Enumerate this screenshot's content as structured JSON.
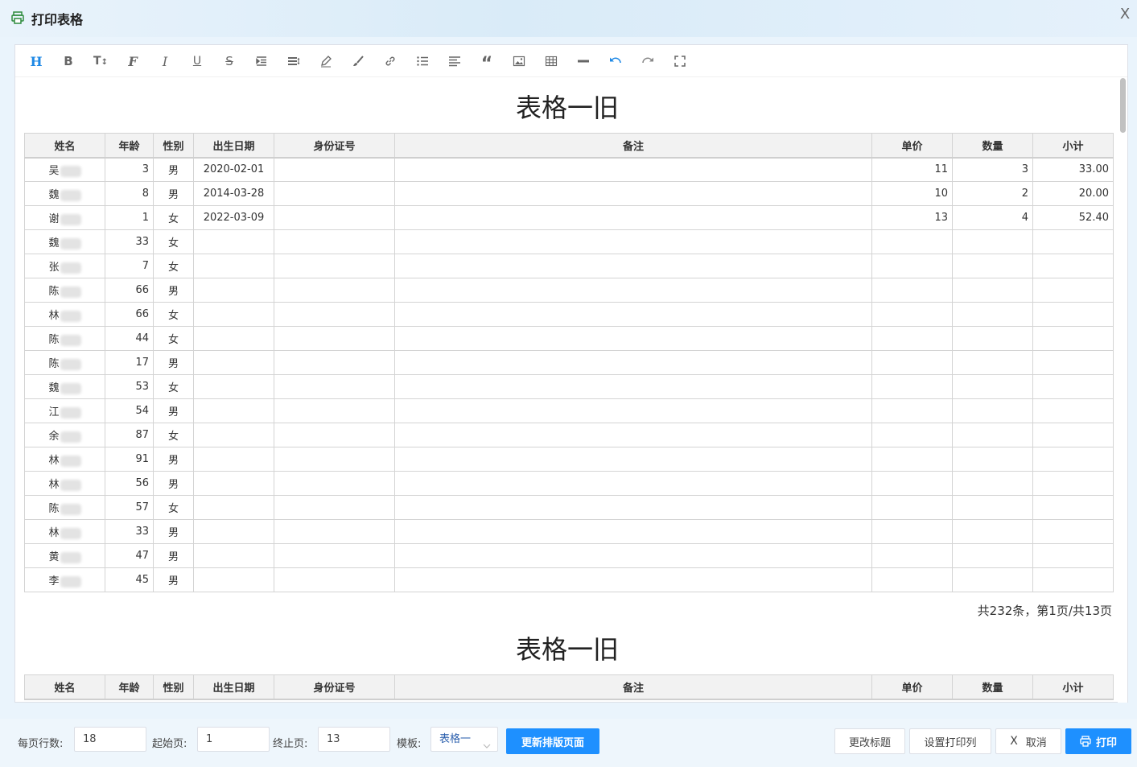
{
  "window": {
    "title": "打印表格",
    "close_label": "X"
  },
  "toolbar": {
    "items": [
      {
        "name": "heading-icon",
        "glyph": "H"
      },
      {
        "name": "bold-icon",
        "glyph": "B"
      },
      {
        "name": "font-size-icon",
        "glyph": "TI"
      },
      {
        "name": "font-family-icon",
        "glyph": "F"
      },
      {
        "name": "italic-icon",
        "glyph": "I"
      },
      {
        "name": "underline-icon",
        "glyph": "U"
      },
      {
        "name": "strikethrough-icon",
        "glyph": "S"
      },
      {
        "name": "indent-icon",
        "glyph": "indent"
      },
      {
        "name": "line-height-icon",
        "glyph": "lh"
      },
      {
        "name": "font-color-icon",
        "glyph": "pen"
      },
      {
        "name": "background-color-icon",
        "glyph": "brush"
      },
      {
        "name": "link-icon",
        "glyph": "link"
      },
      {
        "name": "list-icon",
        "glyph": "list"
      },
      {
        "name": "align-icon",
        "glyph": "align"
      },
      {
        "name": "quote-icon",
        "glyph": "quote"
      },
      {
        "name": "image-icon",
        "glyph": "image"
      },
      {
        "name": "table-icon",
        "glyph": "table"
      },
      {
        "name": "divider-icon",
        "glyph": "hr"
      },
      {
        "name": "undo-icon",
        "glyph": "undo"
      },
      {
        "name": "redo-icon",
        "glyph": "redo"
      },
      {
        "name": "fullscreen-icon",
        "glyph": "full"
      }
    ],
    "accent": "#1e88e5"
  },
  "document": {
    "page_title": "表格一旧",
    "columns": [
      "姓名",
      "年龄",
      "性别",
      "出生日期",
      "身份证号",
      "备注",
      "单价",
      "数量",
      "小计"
    ],
    "rows": [
      {
        "name": "吴",
        "age": "3",
        "sex": "男",
        "dob": "2020-02-01",
        "id": "",
        "note": "",
        "price": "11",
        "qty": "3",
        "sub": "33.00"
      },
      {
        "name": "魏",
        "age": "8",
        "sex": "男",
        "dob": "2014-03-28",
        "id": "",
        "note": "",
        "price": "10",
        "qty": "2",
        "sub": "20.00"
      },
      {
        "name": "谢",
        "age": "1",
        "sex": "女",
        "dob": "2022-03-09",
        "id": "",
        "note": "",
        "price": "13",
        "qty": "4",
        "sub": "52.40"
      },
      {
        "name": "魏",
        "age": "33",
        "sex": "女",
        "dob": "",
        "id": "",
        "note": "",
        "price": "",
        "qty": "",
        "sub": ""
      },
      {
        "name": "张",
        "age": "7",
        "sex": "女",
        "dob": "",
        "id": "",
        "note": "",
        "price": "",
        "qty": "",
        "sub": ""
      },
      {
        "name": "陈",
        "age": "66",
        "sex": "男",
        "dob": "",
        "id": "",
        "note": "",
        "price": "",
        "qty": "",
        "sub": ""
      },
      {
        "name": "林",
        "age": "66",
        "sex": "女",
        "dob": "",
        "id": "",
        "note": "",
        "price": "",
        "qty": "",
        "sub": ""
      },
      {
        "name": "陈",
        "age": "44",
        "sex": "女",
        "dob": "",
        "id": "",
        "note": "",
        "price": "",
        "qty": "",
        "sub": ""
      },
      {
        "name": "陈",
        "age": "17",
        "sex": "男",
        "dob": "",
        "id": "",
        "note": "",
        "price": "",
        "qty": "",
        "sub": ""
      },
      {
        "name": "魏",
        "age": "53",
        "sex": "女",
        "dob": "",
        "id": "",
        "note": "",
        "price": "",
        "qty": "",
        "sub": ""
      },
      {
        "name": "江",
        "age": "54",
        "sex": "男",
        "dob": "",
        "id": "",
        "note": "",
        "price": "",
        "qty": "",
        "sub": ""
      },
      {
        "name": "余",
        "age": "87",
        "sex": "女",
        "dob": "",
        "id": "",
        "note": "",
        "price": "",
        "qty": "",
        "sub": ""
      },
      {
        "name": "林",
        "age": "91",
        "sex": "男",
        "dob": "",
        "id": "",
        "note": "",
        "price": "",
        "qty": "",
        "sub": ""
      },
      {
        "name": "林",
        "age": "56",
        "sex": "男",
        "dob": "",
        "id": "",
        "note": "",
        "price": "",
        "qty": "",
        "sub": ""
      },
      {
        "name": "陈",
        "age": "57",
        "sex": "女",
        "dob": "",
        "id": "",
        "note": "",
        "price": "",
        "qty": "",
        "sub": ""
      },
      {
        "name": "林",
        "age": "33",
        "sex": "男",
        "dob": "",
        "id": "",
        "note": "",
        "price": "",
        "qty": "",
        "sub": ""
      },
      {
        "name": "黄",
        "age": "47",
        "sex": "男",
        "dob": "",
        "id": "",
        "note": "",
        "price": "",
        "qty": "",
        "sub": ""
      },
      {
        "name": "李",
        "age": "45",
        "sex": "男",
        "dob": "",
        "id": "",
        "note": "",
        "price": "",
        "qty": "",
        "sub": ""
      }
    ],
    "page_info": "共232条，第1页/共13页",
    "page2_title": "表格一旧"
  },
  "footer": {
    "rows_per_page_label": "每页行数:",
    "rows_per_page_value": "18",
    "start_page_label": "起始页:",
    "start_page_value": "1",
    "end_page_label": "终止页:",
    "end_page_value": "13",
    "template_label": "模板:",
    "template_value": "表格一",
    "refresh_button": "更新排版页面",
    "change_title_button": "更改标题",
    "set_columns_button": "设置打印列",
    "cancel_button": "取消",
    "cancel_icon": "X",
    "print_button": "打印"
  }
}
